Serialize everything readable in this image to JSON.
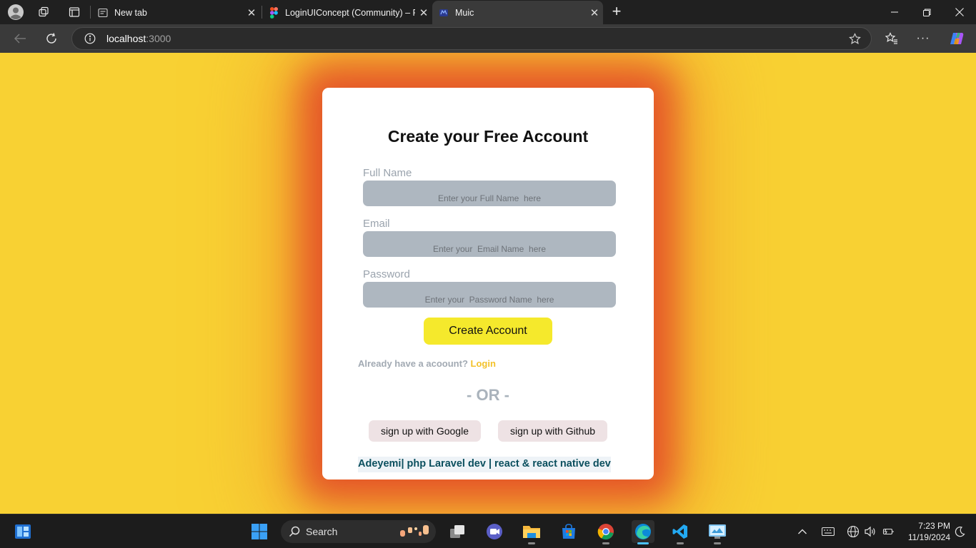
{
  "browser": {
    "tabs": [
      {
        "title": "New tab",
        "active": false
      },
      {
        "title": "LoginUIConcept (Community) – Fi",
        "active": false
      },
      {
        "title": "Muic",
        "active": true
      }
    ],
    "url_host": "localhost",
    "url_port": ":3000",
    "new_tab_symbol": "+"
  },
  "page": {
    "background_color": "#f8d133",
    "heading": "Create your Free Account",
    "fields": [
      {
        "label": "Full Name",
        "placeholder": "Enter your Full Name  here"
      },
      {
        "label": "Email",
        "placeholder": "Enter your  Email Name  here"
      },
      {
        "label": "Password",
        "placeholder": "Enter your  Password Name  here"
      }
    ],
    "create_button": "Create Account",
    "already_text": "Already have a acoount?",
    "login_link": "Login",
    "or_text": "- OR -",
    "google_button": "sign up with Google",
    "github_button": "sign up with Github",
    "credit": "Adeyemi| php Laravel dev | react & react native dev"
  },
  "taskbar": {
    "search_label": "Search",
    "time": "7:23 PM",
    "date": "11/19/2024",
    "apps": [
      "start-icon",
      "task-view-icon",
      "meet-icon",
      "file-explorer-icon",
      "ms-store-icon",
      "chrome-icon",
      "edge-icon",
      "vscode-icon",
      "control-panel-icon"
    ]
  },
  "colors": {
    "accent_yellow": "#f5e92c",
    "login_link": "#f3c22a",
    "credit_text": "#0b4f5e",
    "input_bg": "#aeb7c0"
  }
}
